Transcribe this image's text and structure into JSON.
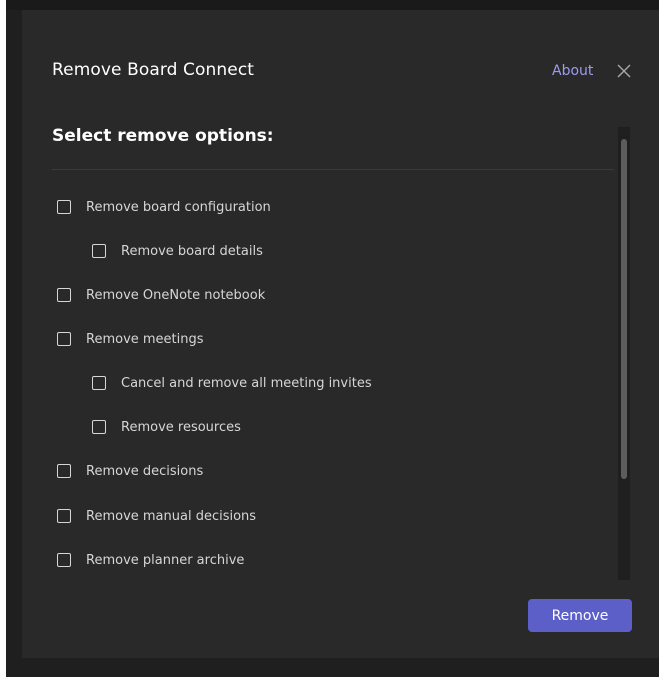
{
  "dialog": {
    "title": "Remove Board Connect",
    "about_label": "About",
    "close_icon": "close-icon"
  },
  "content": {
    "heading": "Select remove options:",
    "options": [
      {
        "label": "Remove board configuration",
        "checked": false,
        "indent": 0
      },
      {
        "label": "Remove board details",
        "checked": false,
        "indent": 1
      },
      {
        "label": "Remove OneNote notebook",
        "checked": false,
        "indent": 0
      },
      {
        "label": "Remove meetings",
        "checked": false,
        "indent": 0
      },
      {
        "label": "Cancel and remove all meeting invites",
        "checked": false,
        "indent": 1
      },
      {
        "label": "Remove resources",
        "checked": false,
        "indent": 1
      },
      {
        "label": "Remove decisions",
        "checked": false,
        "indent": 0
      },
      {
        "label": "Remove manual decisions",
        "checked": false,
        "indent": 0
      },
      {
        "label": "Remove planner archive",
        "checked": false,
        "indent": 0
      }
    ]
  },
  "footer": {
    "remove_label": "Remove"
  },
  "colors": {
    "accent": "#5b5fc7",
    "link": "#9c9bf0",
    "dialog_bg": "#292929"
  }
}
